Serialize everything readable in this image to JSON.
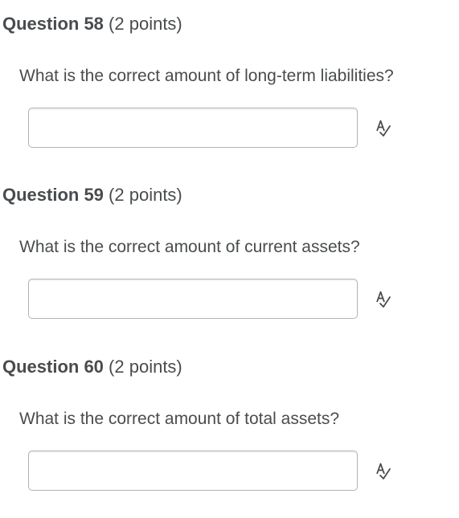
{
  "questions": [
    {
      "title": "Question 58",
      "points": "(2 points)",
      "prompt": "What is the correct amount of long-term liabilities?",
      "answer_value": "",
      "icon": "spell-check-icon"
    },
    {
      "title": "Question 59",
      "points": "(2 points)",
      "prompt": "What is the correct amount of current assets?",
      "answer_value": "",
      "icon": "spell-check-icon"
    },
    {
      "title": "Question 60",
      "points": "(2 points)",
      "prompt": "What is the correct amount of total assets?",
      "answer_value": "",
      "icon": "spell-check-icon"
    }
  ],
  "colors": {
    "text": "#494c4e",
    "input_border": "#b0b3b5"
  }
}
